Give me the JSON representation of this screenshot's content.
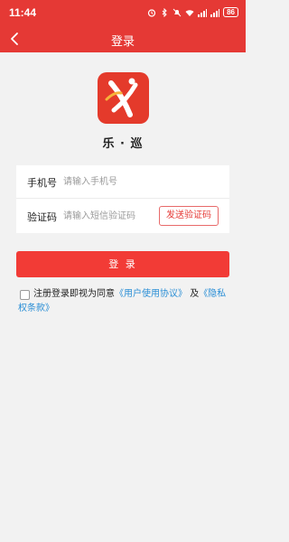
{
  "status": {
    "time": "11:44",
    "battery": "86"
  },
  "nav": {
    "title": "登录"
  },
  "app": {
    "name": "乐 · 巡"
  },
  "form": {
    "phone": {
      "label": "手机号",
      "placeholder": "请输入手机号",
      "value": ""
    },
    "code": {
      "label": "验证码",
      "placeholder": "请输入短信验证码",
      "value": "",
      "send_button": "发送验证码"
    }
  },
  "login_button": "登 录",
  "agreement": {
    "prefix": "注册登录即视为同意",
    "user_agreement": "《用户使用协议》",
    "and": "及",
    "privacy_policy": "《隐私权条款》",
    "checked": false
  },
  "colors": {
    "brand": "#e53935",
    "button": "#f23b36",
    "link": "#2b8fd6",
    "background": "#f2f2f2"
  }
}
